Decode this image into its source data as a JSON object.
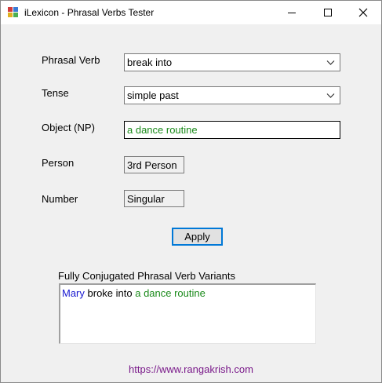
{
  "window": {
    "title": "iLexicon - Phrasal Verbs Tester",
    "icon": "app-icon",
    "controls": {
      "minimize": "minimize-icon",
      "maximize": "maximize-icon",
      "close": "✕"
    }
  },
  "form": {
    "phrasal_verb": {
      "label": "Phrasal Verb",
      "value": "break into"
    },
    "tense": {
      "label": "Tense",
      "value": "simple past"
    },
    "object": {
      "label": "Object (NP)",
      "value": "a dance routine"
    },
    "person": {
      "label": "Person",
      "value": "3rd Person"
    },
    "number": {
      "label": "Number",
      "value": "Singular"
    },
    "apply_label": "Apply"
  },
  "results": {
    "label": "Fully Conjugated Phrasal Verb Variants",
    "subject": "Mary",
    "verb": "broke into",
    "object": "a dance routine"
  },
  "footer": {
    "link": "https://www.rangakrish.com"
  },
  "colors": {
    "subject": "#1a1ad0",
    "object": "#1a8a1a",
    "link": "#7a1a8a",
    "accent": "#0078d7"
  }
}
